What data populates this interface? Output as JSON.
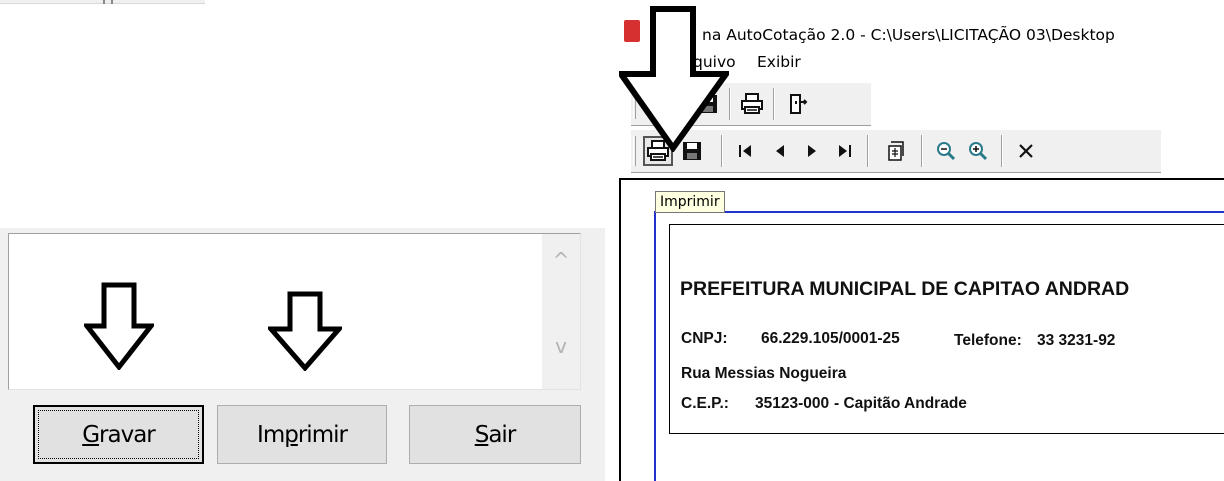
{
  "left_panel": {
    "buttons": {
      "gravar": {
        "accel": "G",
        "rest": "ravar"
      },
      "imprimir": {
        "pre": "Im",
        "accel": "p",
        "rest": "rimir"
      },
      "sair": {
        "accel": "S",
        "rest": "air"
      }
    },
    "scroll_up_glyph": "^",
    "scroll_down_glyph": "v"
  },
  "window": {
    "title": "na AutoCotação 2.0 - C:\\Users\\LICITAÇÃO 03\\Desktop",
    "icon_color": "#d63031",
    "menu": {
      "arquivo": "quivo",
      "exibir": "Exibir"
    }
  },
  "toolbar1": {
    "icons": [
      "save-icon",
      "print-icon",
      "exit-door-icon"
    ]
  },
  "toolbar2": {
    "icons": [
      "print-icon",
      "save-icon",
      "first-page-icon",
      "prev-page-icon",
      "next-page-icon",
      "last-page-icon",
      "page-setup-icon",
      "zoom-out-icon",
      "zoom-in-icon",
      "close-icon"
    ]
  },
  "tooltip": {
    "text": "Imprimir"
  },
  "report": {
    "title": "PREFEITURA MUNICIPAL DE CAPITAO ANDRAD",
    "cnpj_label": "CNPJ:",
    "cnpj_value": "66.229.105/0001-25",
    "telefone_label": "Telefone:",
    "telefone_value": "33 3231-92",
    "rua": "Rua Messias Nogueira",
    "cep_label": "C.E.P.:",
    "cep_value": "35123-000",
    "cidade": "-  Capitão Andrade"
  },
  "colors": {
    "panel_bg": "#f0f0f0",
    "button_bg": "#e1e1e1",
    "report_frame": "#2233cc",
    "tooltip_bg": "#ffffe1"
  }
}
